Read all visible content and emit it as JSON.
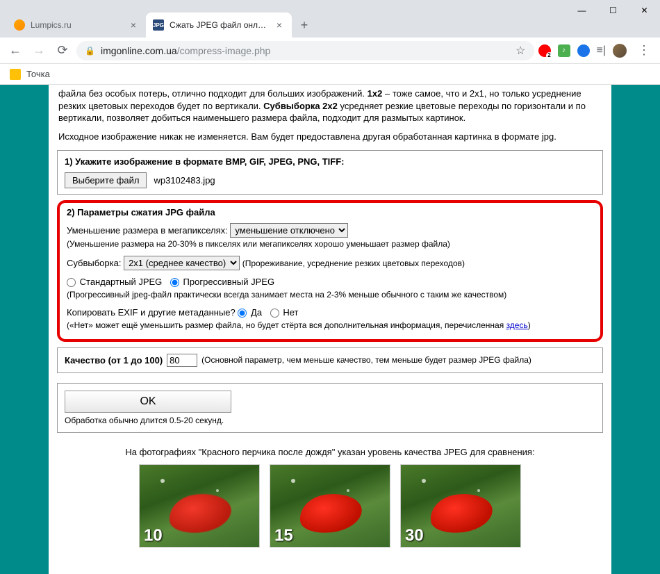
{
  "window": {
    "tabs": [
      {
        "title": "Lumpics.ru"
      },
      {
        "title": "Сжать JPEG файл онлайн - IMG..."
      }
    ],
    "url_host": "imgonline.com.ua",
    "url_path": "/compress-image.php"
  },
  "bookmarks": {
    "item1": "Точка"
  },
  "intro": {
    "p1_part1": "файла без особых потерь, отлично подходит для больших изображений. ",
    "p1_bold1": "1x2",
    "p1_part2": " – тоже самое, что и 2x1, но только усреднение резких цветовых переходов будет по вертикали. ",
    "p1_bold2": "Субвыборка 2x2",
    "p1_part3": " усредняет резкие цветовые переходы по горизонтали и по вертикали, позволяет добиться наименьшего размера файла, подходит для размытых картинок.",
    "p2": "Исходное изображение никак не изменяется. Вам будет предоставлена другая обработанная картинка в формате jpg."
  },
  "section1": {
    "title": "1) Укажите изображение в формате BMP, GIF, JPEG, PNG, TIFF:",
    "button": "Выберите файл",
    "filename": "wp3102483.jpg"
  },
  "section2": {
    "title": "2) Параметры сжатия JPG файла",
    "mp_label": "Уменьшение размера в мегапикселях:",
    "mp_option": "уменьшение отключено",
    "mp_hint": "(Уменьшение размера на 20-30% в пикселях или мегапикселях хорошо уменьшает размер файла)",
    "sub_label": "Субвыборка:",
    "sub_option": "2x1 (среднее качество)",
    "sub_hint": "(Прореживание, усреднение резких цветовых переходов)",
    "jpeg_std": "Стандартный JPEG",
    "jpeg_prog": "Прогрессивный JPEG",
    "jpeg_hint": "(Прогрессивный jpeg-файл практически всегда занимает места на 2-3% меньше обычного с таким же качеством)",
    "exif_label": "Копировать EXIF и другие метаданные?",
    "exif_yes": "Да",
    "exif_no": "Нет",
    "exif_hint_pre": "(«Нет» может ещё уменьшить размер файла, но будет стёрта вся дополнительная информация, перечисленная ",
    "exif_link": "здесь",
    "exif_hint_post": ")"
  },
  "quality": {
    "label": "Качество (от 1 до 100)",
    "value": "80",
    "hint": "(Основной параметр, чем меньше качество, тем меньше будет размер JPEG файла)"
  },
  "ok": {
    "button": "OK",
    "note": "Обработка обычно длится 0.5-20 секунд."
  },
  "thumbs": {
    "caption": "На фотографиях \"Красного перчика после дождя\" указан уровень качества JPEG для сравнения:",
    "labels": [
      "10",
      "15",
      "30"
    ]
  }
}
